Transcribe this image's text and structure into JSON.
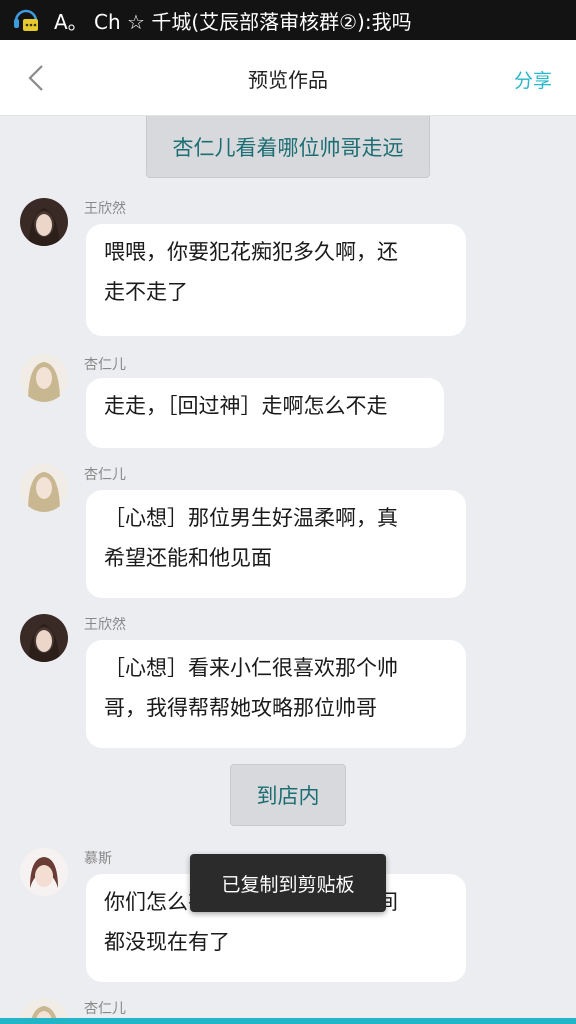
{
  "status_bar": {
    "notification_text": "A。 Ch ☆ 千城(艾辰部落审核群②):我吗",
    "icon": "headset-chat-icon"
  },
  "nav": {
    "back_icon": "chevron-left-icon",
    "title": "预览作品",
    "share_label": "分享",
    "accent_color": "#2ab7c9"
  },
  "scenes": [
    {
      "label": "杏仁儿看着哪位帅哥走远"
    },
    {
      "label": "到店内"
    }
  ],
  "messages": [
    {
      "sender": "王欣然",
      "lines": [
        "喂喂，你要犯花痴犯多久啊，还",
        "走不走了"
      ]
    },
    {
      "sender": "杏仁儿",
      "lines": [
        "走走，［回过神］走啊怎么不走"
      ]
    },
    {
      "sender": "杏仁儿",
      "lines": [
        "［心想］那位男生好温柔啊，真",
        "希望还能和他见面"
      ]
    },
    {
      "sender": "王欣然",
      "lines": [
        "［心想］看来小仁很喜欢那个帅",
        "哥，我得帮帮她攻略那位帅哥"
      ]
    },
    {
      "sender": "慕斯",
      "lines": [
        "你们怎么有空来啊，有的是时间",
        "都没现在有了"
      ]
    },
    {
      "sender": "杏仁儿",
      "lines": []
    }
  ],
  "toast": {
    "text": "已复制到剪贴板"
  }
}
